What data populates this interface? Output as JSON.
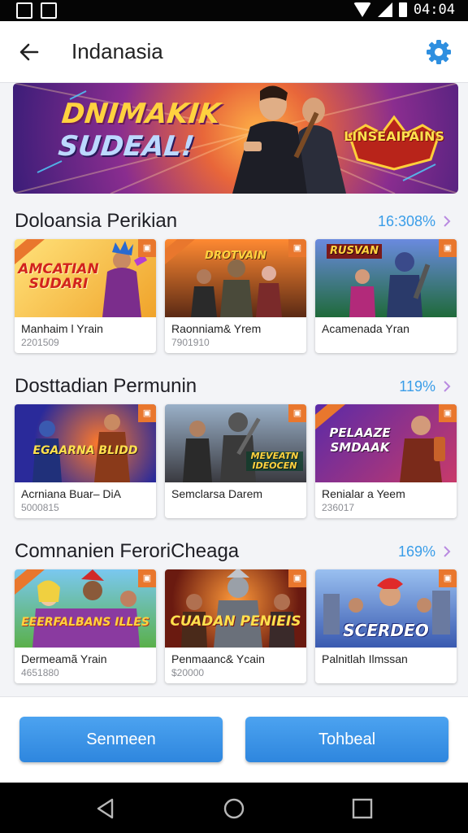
{
  "status_bar": {
    "time": "04:04"
  },
  "header": {
    "title": "Indanasia"
  },
  "banner": {
    "line1": "DNIMAKIK",
    "line2": "SUDEAL!",
    "badge_text": "LINSEAIPAINS"
  },
  "sections": [
    {
      "title": "Doloansia Perikian",
      "value": "16:308%",
      "items": [
        {
          "thumb_text": "AMCATIAN SUDARI",
          "title": "Manhaim l Yrain",
          "subtitle": "2201509",
          "bg": "#f3b83a"
        },
        {
          "thumb_text": "DROTVAIN",
          "title": "Raonniam& Yrem",
          "subtitle": "7901910",
          "bg": "#7a3d1e"
        },
        {
          "thumb_text": "RUSVAN",
          "title": "Acamenada Yran",
          "subtitle": "",
          "bg": "#2c7d4a"
        }
      ]
    },
    {
      "title": "Dosttadian Permunin",
      "value": "119%",
      "items": [
        {
          "thumb_text": "EGAARNA BLIDD",
          "title": "Acrniana Buar– DiA",
          "subtitle": "5000815",
          "bg": "#2a3b9a"
        },
        {
          "thumb_text": "MEVEATN IDEOCEN",
          "title": "Semclarsa Darem",
          "subtitle": "",
          "bg": "#4b5560"
        },
        {
          "thumb_text": "PELAAZE SMDAAK",
          "title": "Renialar a Yeem",
          "subtitle": "236017",
          "bg": "#4a2a8c"
        }
      ]
    },
    {
      "title": "Comnanien FeroriCheaga",
      "value": "169%",
      "items": [
        {
          "thumb_text": "EEERFALBANS ILLES",
          "title": "Dermeamã Yrain",
          "subtitle": "4651880",
          "bg": "#6dbb4a"
        },
        {
          "thumb_text": "CUADAN PENIEIS",
          "title": "Penmaanc& Ycain",
          "subtitle": "$20000",
          "bg": "#b0381e"
        },
        {
          "thumb_text": "SCERDEO",
          "title": "Palnitlah Ilmssan",
          "subtitle": "",
          "bg": "#3c6fb8"
        }
      ]
    }
  ],
  "buttons": {
    "left": "Senmeen",
    "right": "Tohbeal"
  },
  "icons": {
    "back": "arrow-left-icon",
    "settings": "gear-icon",
    "section_more": "chevron-right-icon",
    "nav_back": "triangle-back-icon",
    "nav_home": "circle-home-icon",
    "nav_recents": "square-recents-icon"
  },
  "colors": {
    "accent": "#2e86de",
    "section_value": "#3a9de8",
    "badge": "#e9772d"
  }
}
